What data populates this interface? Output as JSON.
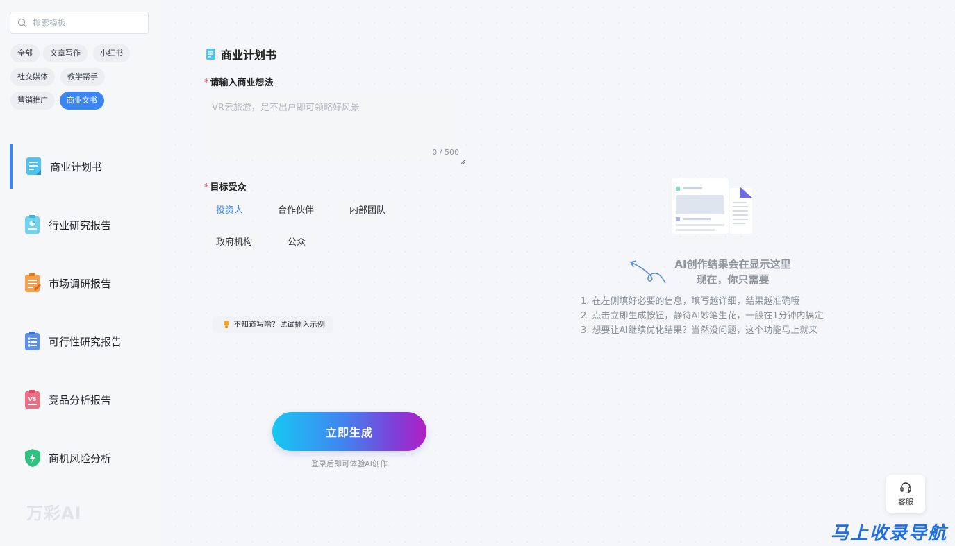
{
  "sidebar": {
    "search_placeholder": "搜索模板",
    "tags": [
      {
        "label": "全部"
      },
      {
        "label": "文章写作"
      },
      {
        "label": "小红书"
      },
      {
        "label": "社交媒体"
      },
      {
        "label": "教学帮手"
      },
      {
        "label": "营销推广"
      },
      {
        "label": "商业文书",
        "active": true
      }
    ],
    "nav": [
      {
        "label": "商业计划书",
        "icon": "business-plan-icon",
        "active": true
      },
      {
        "label": "行业研究报告",
        "icon": "industry-report-icon"
      },
      {
        "label": "市场调研报告",
        "icon": "market-research-icon"
      },
      {
        "label": "可行性研究报告",
        "icon": "feasibility-report-icon"
      },
      {
        "label": "竞品分析报告",
        "icon": "vs-analysis-icon"
      },
      {
        "label": "商机风险分析",
        "icon": "risk-shield-icon"
      }
    ],
    "brand": {
      "logo": "万彩AI"
    }
  },
  "form": {
    "title": "商业计划书",
    "idea_label": "请输入商业想法",
    "idea_placeholder": "VR云旅游，足不出户即可领略好风景",
    "idea_value": "",
    "counter": "0 / 500",
    "audience_label": "目标受众",
    "audience": [
      {
        "label": "投资人",
        "selected": true
      },
      {
        "label": "合作伙伴"
      },
      {
        "label": "内部团队"
      },
      {
        "label": "政府机构"
      },
      {
        "label": "公众"
      }
    ],
    "example_hint": "不知道写啥？试试插入示例",
    "generate_label": "立即生成",
    "login_hint": "登录后即可体验AI创作"
  },
  "result": {
    "title_line1": "AI创作结果会在显示这里",
    "title_line2": "现在，你只需要",
    "steps": [
      "1. 在左侧填好必要的信息，填写越详细，结果越准确哦",
      "2. 点击立即生成按钮，静待AI妙笔生花，一般在1分钟内搞定",
      "3. 想要让AI继续优化结果？当然没问题，这个功能马上就来"
    ]
  },
  "service": {
    "label": "客服"
  },
  "watermark": "马上收录导航",
  "colors": {
    "accent": "#3b86f2",
    "required": "#e5484d"
  }
}
